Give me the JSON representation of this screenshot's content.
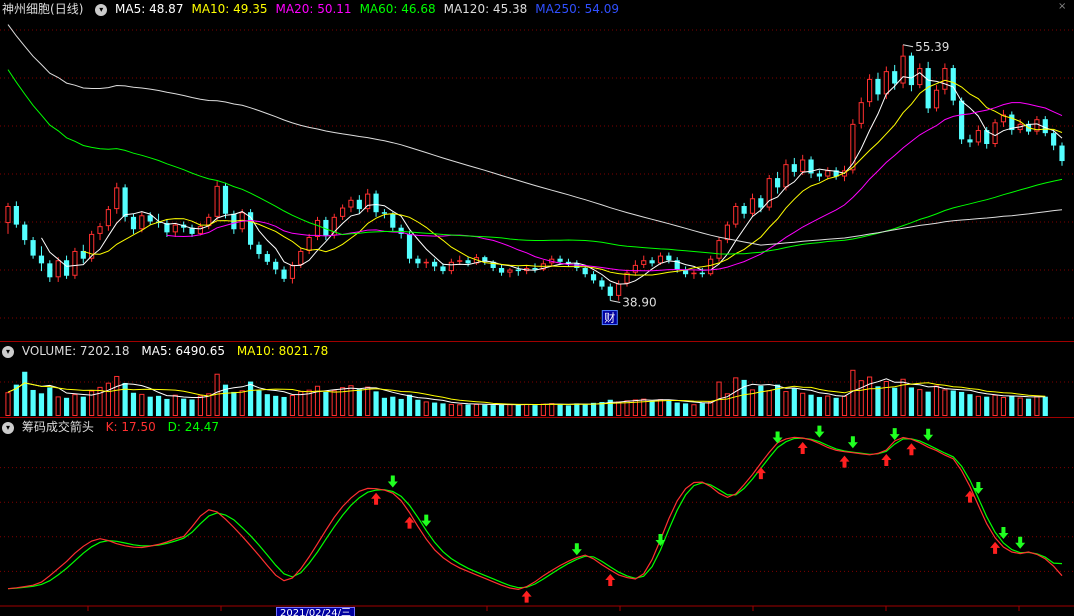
{
  "stock": {
    "name": "神州细胞",
    "period": "(日线)"
  },
  "price_legend": [
    {
      "label": "MA5: 48.87",
      "color": "#ffffff"
    },
    {
      "label": "MA10: 49.35",
      "color": "#ffff00"
    },
    {
      "label": "MA20: 50.11",
      "color": "#ff00ff"
    },
    {
      "label": "MA60: 46.68",
      "color": "#00ff00"
    },
    {
      "label": "MA120: 45.38",
      "color": "#dddddd"
    },
    {
      "label": "MA250: 54.09",
      "color": "#3050ff"
    }
  ],
  "price_annotations": {
    "high": "55.39",
    "low": "38.90",
    "marker": "财"
  },
  "volume_header": {
    "title": "VOLUME: 7202.18",
    "ma5": "MA5: 6490.65",
    "ma10": "MA10: 8021.78",
    "colors": {
      "title": "#dddddd",
      "ma5": "#ffffff",
      "ma10": "#ffff00"
    }
  },
  "indicator_header": {
    "title": "筹码成交箭头",
    "k": "K: 17.50",
    "d": "D: 24.47",
    "colors": {
      "title": "#dddddd",
      "k": "#ff3030",
      "d": "#00ff00"
    }
  },
  "date_label": "2021/02/24/三",
  "colors": {
    "up": "#ff3030",
    "down": "#54ffff",
    "grid": "#800000",
    "bg": "#000000"
  },
  "chart_data": {
    "type": "candlestick",
    "price_range": [
      37,
      57
    ],
    "candles": [
      [
        43.9,
        45.2,
        43.2,
        45.0
      ],
      [
        45.0,
        45.3,
        43.6,
        43.8
      ],
      [
        43.8,
        44.0,
        42.5,
        42.8
      ],
      [
        42.8,
        43.0,
        41.6,
        41.8
      ],
      [
        41.8,
        42.4,
        40.8,
        41.3
      ],
      [
        41.3,
        41.5,
        40.1,
        40.4
      ],
      [
        40.4,
        41.7,
        40.1,
        41.5
      ],
      [
        41.5,
        41.8,
        40.3,
        40.5
      ],
      [
        40.5,
        42.3,
        40.3,
        42.1
      ],
      [
        42.1,
        42.5,
        41.3,
        41.6
      ],
      [
        41.6,
        43.4,
        41.4,
        43.2
      ],
      [
        43.2,
        43.9,
        42.8,
        43.7
      ],
      [
        43.7,
        45.0,
        43.4,
        44.8
      ],
      [
        44.8,
        46.5,
        44.5,
        46.2
      ],
      [
        46.2,
        46.4,
        44.0,
        44.3
      ],
      [
        44.3,
        44.5,
        43.2,
        43.5
      ],
      [
        43.5,
        44.6,
        43.3,
        44.4
      ],
      [
        44.4,
        44.6,
        43.8,
        44.0
      ],
      [
        44.0,
        44.5,
        43.6,
        43.9
      ],
      [
        43.9,
        44.1,
        43.0,
        43.3
      ],
      [
        43.3,
        43.9,
        43.0,
        43.8
      ],
      [
        43.8,
        44.0,
        43.3,
        43.6
      ],
      [
        43.6,
        43.8,
        43.0,
        43.2
      ],
      [
        43.2,
        43.9,
        43.1,
        43.7
      ],
      [
        43.7,
        44.5,
        43.5,
        44.3
      ],
      [
        44.3,
        46.6,
        44.1,
        46.3
      ],
      [
        46.3,
        46.5,
        44.2,
        44.5
      ],
      [
        44.5,
        44.7,
        43.2,
        43.5
      ],
      [
        43.5,
        44.8,
        43.3,
        44.6
      ],
      [
        44.6,
        44.8,
        42.2,
        42.5
      ],
      [
        42.5,
        42.7,
        41.6,
        41.9
      ],
      [
        41.9,
        42.1,
        41.2,
        41.4
      ],
      [
        41.4,
        41.6,
        40.6,
        40.9
      ],
      [
        40.9,
        41.1,
        40.1,
        40.3
      ],
      [
        40.3,
        41.4,
        40.0,
        41.2
      ],
      [
        41.2,
        42.3,
        41.0,
        42.1
      ],
      [
        42.1,
        43.2,
        41.9,
        43.0
      ],
      [
        43.0,
        44.3,
        42.8,
        44.1
      ],
      [
        44.1,
        44.3,
        42.8,
        43.1
      ],
      [
        43.1,
        44.5,
        42.9,
        44.3
      ],
      [
        44.3,
        45.1,
        44.1,
        44.9
      ],
      [
        44.9,
        45.6,
        44.6,
        45.4
      ],
      [
        45.4,
        45.7,
        44.5,
        44.8
      ],
      [
        44.8,
        46.1,
        44.6,
        45.8
      ],
      [
        45.8,
        46.0,
        44.3,
        44.6
      ],
      [
        44.6,
        44.8,
        44.2,
        44.5
      ],
      [
        44.5,
        44.6,
        43.4,
        43.6
      ],
      [
        43.6,
        43.8,
        42.9,
        43.2
      ],
      [
        43.2,
        43.4,
        41.3,
        41.6
      ],
      [
        41.6,
        41.8,
        41.0,
        41.3
      ],
      [
        41.3,
        41.6,
        41.0,
        41.4
      ],
      [
        41.4,
        41.6,
        40.8,
        41.1
      ],
      [
        41.1,
        41.3,
        40.6,
        40.8
      ],
      [
        40.8,
        41.6,
        40.6,
        41.4
      ],
      [
        41.4,
        41.8,
        41.2,
        41.5
      ],
      [
        41.5,
        41.7,
        41.1,
        41.3
      ],
      [
        41.3,
        41.9,
        41.2,
        41.7
      ],
      [
        41.7,
        41.8,
        41.2,
        41.4
      ],
      [
        41.4,
        41.5,
        40.8,
        41.0
      ],
      [
        41.0,
        41.2,
        40.5,
        40.7
      ],
      [
        40.7,
        41.0,
        40.4,
        40.9
      ],
      [
        40.9,
        41.1,
        40.5,
        40.8
      ],
      [
        40.8,
        41.2,
        40.6,
        41.0
      ],
      [
        41.0,
        41.3,
        40.7,
        40.9
      ],
      [
        40.9,
        41.5,
        40.8,
        41.3
      ],
      [
        41.3,
        41.8,
        41.1,
        41.6
      ],
      [
        41.6,
        41.8,
        41.2,
        41.4
      ],
      [
        41.4,
        41.6,
        41.1,
        41.3
      ],
      [
        41.3,
        41.5,
        40.8,
        41.0
      ],
      [
        41.0,
        41.2,
        40.4,
        40.6
      ],
      [
        40.6,
        40.8,
        40.0,
        40.2
      ],
      [
        40.2,
        40.4,
        39.6,
        39.8
      ],
      [
        39.8,
        40.0,
        38.9,
        39.2
      ],
      [
        39.2,
        40.2,
        38.9,
        40.0
      ],
      [
        40.0,
        40.9,
        39.8,
        40.7
      ],
      [
        40.7,
        41.5,
        40.5,
        41.2
      ],
      [
        41.2,
        41.8,
        41.0,
        41.5
      ],
      [
        41.5,
        41.7,
        41.1,
        41.3
      ],
      [
        41.3,
        42.0,
        41.2,
        41.8
      ],
      [
        41.8,
        42.0,
        41.3,
        41.5
      ],
      [
        41.5,
        41.7,
        40.7,
        40.9
      ],
      [
        40.9,
        41.1,
        40.4,
        40.6
      ],
      [
        40.6,
        40.9,
        40.3,
        40.7
      ],
      [
        40.7,
        41.0,
        40.4,
        40.6
      ],
      [
        40.6,
        41.8,
        40.5,
        41.6
      ],
      [
        41.6,
        43.0,
        41.4,
        42.8
      ],
      [
        42.8,
        44.0,
        42.6,
        43.8
      ],
      [
        43.8,
        45.2,
        43.6,
        45.0
      ],
      [
        45.0,
        45.2,
        44.2,
        44.5
      ],
      [
        44.5,
        45.8,
        44.3,
        45.5
      ],
      [
        45.5,
        45.7,
        44.6,
        44.9
      ],
      [
        44.9,
        47.0,
        44.7,
        46.8
      ],
      [
        46.8,
        47.2,
        45.8,
        46.2
      ],
      [
        46.2,
        48.0,
        46.0,
        47.7
      ],
      [
        47.7,
        48.1,
        46.9,
        47.2
      ],
      [
        47.2,
        48.3,
        47.0,
        48.0
      ],
      [
        48.0,
        48.2,
        46.8,
        47.1
      ],
      [
        47.1,
        47.3,
        46.6,
        46.9
      ],
      [
        46.9,
        47.5,
        46.7,
        47.3
      ],
      [
        47.3,
        47.5,
        46.7,
        46.9
      ],
      [
        46.9,
        47.6,
        46.6,
        47.3
      ],
      [
        47.3,
        50.6,
        47.1,
        50.3
      ],
      [
        50.3,
        52.0,
        50.0,
        51.7
      ],
      [
        51.7,
        53.5,
        51.4,
        53.2
      ],
      [
        53.2,
        53.6,
        51.8,
        52.2
      ],
      [
        52.2,
        54.0,
        51.9,
        53.7
      ],
      [
        53.7,
        54.1,
        52.5,
        52.9
      ],
      [
        52.9,
        55.4,
        52.6,
        54.7
      ],
      [
        54.7,
        54.9,
        52.4,
        52.8
      ],
      [
        52.8,
        54.2,
        52.6,
        53.9
      ],
      [
        53.9,
        54.3,
        51.0,
        51.3
      ],
      [
        51.3,
        52.8,
        51.1,
        52.5
      ],
      [
        52.5,
        54.2,
        52.2,
        53.9
      ],
      [
        53.9,
        54.1,
        51.5,
        51.8
      ],
      [
        51.8,
        52.0,
        49.0,
        49.3
      ],
      [
        49.3,
        49.6,
        48.8,
        49.1
      ],
      [
        49.1,
        50.2,
        48.9,
        49.9
      ],
      [
        49.9,
        50.1,
        48.7,
        49.0
      ],
      [
        49.0,
        50.6,
        48.8,
        50.4
      ],
      [
        50.4,
        51.2,
        50.1,
        50.9
      ],
      [
        50.9,
        51.1,
        49.6,
        49.9
      ],
      [
        49.9,
        50.6,
        49.7,
        50.3
      ],
      [
        50.3,
        50.5,
        49.6,
        49.8
      ],
      [
        49.8,
        50.8,
        49.6,
        50.6
      ],
      [
        50.6,
        50.8,
        49.5,
        49.7
      ],
      [
        49.7,
        49.9,
        48.6,
        48.9
      ],
      [
        48.9,
        49.1,
        47.6,
        47.9
      ]
    ],
    "volume_range": [
      0,
      20000
    ],
    "volumes": [
      8500,
      11200,
      15800,
      9300,
      8100,
      10200,
      7000,
      6500,
      7800,
      6900,
      9100,
      10400,
      11900,
      14300,
      11800,
      8300,
      7900,
      6900,
      7200,
      6100,
      7600,
      6200,
      5900,
      7300,
      8100,
      15100,
      11200,
      8600,
      9200,
      12300,
      9100,
      7800,
      7200,
      6800,
      7500,
      8900,
      9400,
      10800,
      8600,
      9200,
      10300,
      11000,
      9600,
      10500,
      8800,
      6500,
      6900,
      6100,
      7600,
      5800,
      5200,
      4800,
      4500,
      4300,
      4200,
      4100,
      4300,
      4000,
      3900,
      4100,
      4200,
      4000,
      4300,
      3900,
      4400,
      4600,
      4100,
      3800,
      4500,
      4200,
      4700,
      5000,
      5800,
      5200,
      5600,
      5900,
      6200,
      5400,
      6000,
      5500,
      4800,
      4500,
      4200,
      4600,
      5200,
      12300,
      8100,
      13800,
      12900,
      9500,
      10800,
      9200,
      11200,
      8900,
      9900,
      8300,
      7600,
      6800,
      7300,
      6500,
      7200,
      16500,
      12800,
      14100,
      10600,
      12500,
      10100,
      13300,
      10200,
      9600,
      8700,
      10900,
      9500,
      9100,
      8600,
      7800,
      7200,
      6900,
      7600,
      6800,
      7300,
      6600,
      6200,
      7200,
      6900
    ],
    "k_values": [
      10.0,
      10.5,
      11.2,
      12.0,
      13.8,
      17.5,
      21.6,
      25.8,
      30.5,
      34.5,
      37.6,
      38.9,
      37.8,
      36.0,
      34.8,
      34.0,
      33.8,
      34.6,
      35.6,
      37.0,
      38.8,
      40.2,
      45.8,
      52.0,
      55.6,
      54.4,
      50.2,
      45.4,
      40.3,
      34.8,
      29.2,
      23.4,
      17.8,
      14.6,
      16.2,
      21.5,
      28.4,
      36.0,
      43.8,
      51.2,
      57.5,
      62.5,
      66.3,
      68.0,
      67.8,
      67.0,
      65.2,
      60.8,
      54.0,
      46.0,
      38.6,
      32.5,
      28.0,
      24.6,
      22.0,
      20.0,
      18.0,
      16.0,
      14.0,
      12.0,
      10.4,
      9.6,
      11.2,
      14.0,
      17.5,
      20.5,
      23.4,
      25.9,
      28.0,
      29.4,
      27.2,
      23.8,
      20.8,
      18.0,
      16.4,
      15.6,
      18.6,
      26.8,
      38.4,
      50.4,
      60.8,
      67.8,
      71.4,
      71.6,
      69.0,
      65.2,
      62.8,
      64.8,
      70.2,
      76.0,
      82.6,
      88.8,
      94.4,
      96.6,
      97.5,
      97.1,
      96.0,
      94.0,
      91.6,
      90.0,
      89.2,
      88.6,
      88.0,
      87.4,
      88.2,
      90.2,
      95.4,
      97.4,
      96.4,
      94.4,
      91.8,
      89.8,
      87.2,
      85.1,
      78.2,
      69.0,
      58.2,
      47.6,
      39.4,
      34.1,
      31.2,
      30.3,
      31.2,
      29.8,
      27.2,
      23.0,
      17.5
    ],
    "d_values": [
      10.0,
      10.3,
      10.8,
      11.4,
      12.5,
      14.6,
      18.0,
      21.8,
      26.1,
      30.5,
      34.2,
      36.8,
      37.8,
      37.4,
      36.4,
      35.4,
      34.8,
      34.8,
      35.2,
      36.2,
      37.6,
      39.2,
      42.6,
      47.6,
      52.0,
      53.8,
      52.6,
      49.8,
      45.4,
      40.6,
      35.2,
      29.5,
      23.6,
      18.6,
      16.8,
      19.2,
      24.6,
      31.2,
      38.6,
      45.8,
      52.4,
      58.2,
      62.6,
      65.8,
      67.0,
      67.2,
      66.2,
      63.4,
      58.2,
      51.2,
      43.6,
      36.8,
      31.4,
      27.4,
      24.4,
      21.8,
      19.7,
      17.7,
      15.7,
      13.7,
      11.8,
      10.6,
      10.8,
      12.7,
      15.6,
      18.7,
      21.8,
      24.6,
      27.0,
      28.8,
      28.4,
      25.8,
      22.6,
      19.6,
      17.4,
      16.0,
      17.2,
      22.8,
      32.4,
      44.2,
      55.4,
      64.2,
      69.6,
      71.2,
      70.0,
      67.2,
      64.2,
      64.2,
      68.0,
      73.4,
      79.6,
      85.8,
      91.6,
      95.0,
      96.8,
      97.0,
      96.4,
      95.0,
      92.8,
      90.8,
      89.6,
      88.9,
      88.3,
      87.7,
      88.0,
      89.4,
      93.6,
      96.6,
      96.6,
      95.4,
      93.2,
      90.8,
      88.4,
      86.2,
      80.8,
      72.6,
      62.4,
      51.6,
      42.6,
      36.4,
      32.6,
      30.8,
      31.0,
      30.2,
      28.2,
      24.8,
      24.5
    ],
    "buy_arrows": [
      44,
      48,
      62,
      72,
      90,
      95,
      100,
      105,
      108,
      115,
      118
    ],
    "sell_arrows": [
      46,
      50,
      68,
      78,
      92,
      97,
      101,
      106,
      110,
      116,
      119,
      121
    ]
  }
}
